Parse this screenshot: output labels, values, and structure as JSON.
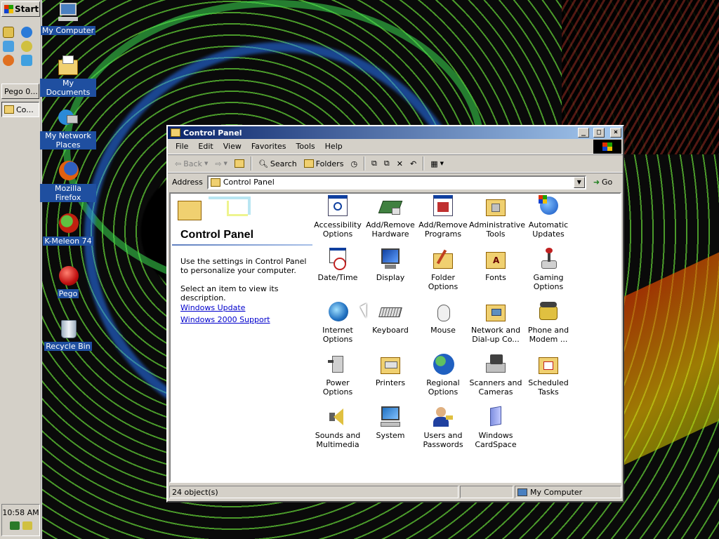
{
  "taskbar": {
    "start_label": "Start",
    "tasks": [
      {
        "label": "Pego 0..."
      },
      {
        "label": "Co..."
      }
    ],
    "clock": "10:58 AM"
  },
  "desktop": {
    "icons": [
      {
        "label": "My Computer",
        "icon": "my-computer-icon"
      },
      {
        "label": "My Documents",
        "icon": "my-documents-icon"
      },
      {
        "label": "My Network Places",
        "icon": "network-places-icon"
      },
      {
        "label": "Mozilla Firefox",
        "icon": "firefox-icon"
      },
      {
        "label": "K-Meleon 74",
        "icon": "k-meleon-icon"
      },
      {
        "label": "Pego",
        "icon": "pego-icon"
      },
      {
        "label": "Recycle Bin",
        "icon": "recycle-bin-icon"
      }
    ]
  },
  "window": {
    "title": "Control Panel",
    "controls": {
      "minimize": "_",
      "maximize": "□",
      "close": "×"
    },
    "menu": [
      "File",
      "Edit",
      "View",
      "Favorites",
      "Tools",
      "Help"
    ],
    "toolbar": {
      "back": "Back",
      "search": "Search",
      "folders": "Folders"
    },
    "address": {
      "label": "Address",
      "value": "Control Panel",
      "go": "Go"
    },
    "left_pane": {
      "title": "Control Panel",
      "text1": "Use the settings in Control Panel to personalize your computer.",
      "text2": "Select an item to view its description.",
      "links": [
        "Windows Update",
        "Windows 2000 Support"
      ]
    },
    "items": [
      {
        "label": "Accessibility Options",
        "icon": "accessibility-icon"
      },
      {
        "label": "Add/Remove Hardware",
        "icon": "add-hardware-icon"
      },
      {
        "label": "Add/Remove Programs",
        "icon": "add-programs-icon"
      },
      {
        "label": "Administrative Tools",
        "icon": "admin-tools-icon"
      },
      {
        "label": "Automatic Updates",
        "icon": "automatic-updates-icon"
      },
      {
        "label": "Date/Time",
        "icon": "date-time-icon"
      },
      {
        "label": "Display",
        "icon": "display-icon"
      },
      {
        "label": "Folder Options",
        "icon": "folder-options-icon"
      },
      {
        "label": "Fonts",
        "icon": "fonts-icon"
      },
      {
        "label": "Gaming Options",
        "icon": "gaming-icon"
      },
      {
        "label": "Internet Options",
        "icon": "internet-options-icon"
      },
      {
        "label": "Keyboard",
        "icon": "keyboard-icon"
      },
      {
        "label": "Mouse",
        "icon": "mouse-icon"
      },
      {
        "label": "Network and Dial-up Co...",
        "icon": "network-icon"
      },
      {
        "label": "Phone and Modem ...",
        "icon": "phone-modem-icon"
      },
      {
        "label": "Power Options",
        "icon": "power-icon"
      },
      {
        "label": "Printers",
        "icon": "printers-icon"
      },
      {
        "label": "Regional Options",
        "icon": "regional-icon"
      },
      {
        "label": "Scanners and Cameras",
        "icon": "scanners-icon"
      },
      {
        "label": "Scheduled Tasks",
        "icon": "scheduled-tasks-icon"
      },
      {
        "label": "Sounds and Multimedia",
        "icon": "sounds-icon"
      },
      {
        "label": "System",
        "icon": "system-icon"
      },
      {
        "label": "Users and Passwords",
        "icon": "users-icon"
      },
      {
        "label": "Windows CardSpace",
        "icon": "cardspace-icon"
      }
    ],
    "status": {
      "objects": "24 object(s)",
      "zone": "My Computer"
    }
  }
}
